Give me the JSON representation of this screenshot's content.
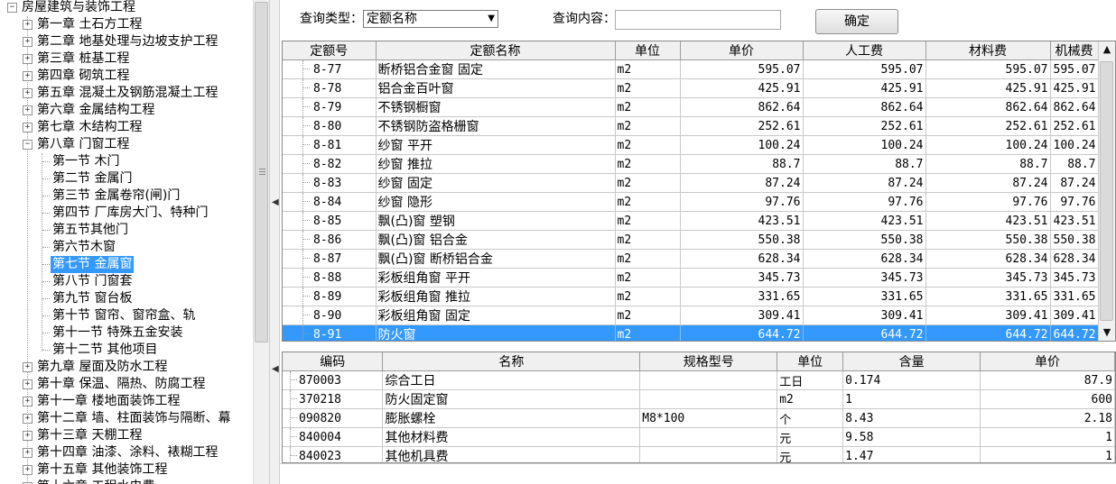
{
  "tree": {
    "root": "房屋建筑与装饰工程",
    "chapters": [
      "第一章 土石方工程",
      "第二章 地基处理与边坡支护工程",
      "第三章 桩基工程",
      "第四章 砌筑工程",
      "第五章 混凝土及钢筋混凝土工程",
      "第六章 金属结构工程",
      "第七章 木结构工程",
      "第八章 门窗工程",
      "第九章 屋面及防水工程",
      "第十章 保温、隔热、防腐工程",
      "第十一章 楼地面装饰工程",
      "第十二章 墙、柱面装饰与隔断、幕",
      "第十三章 天棚工程",
      "第十四章 油漆、涂料、裱糊工程",
      "第十五章 其他装饰工程",
      "第十六章 工程水电费"
    ],
    "chapter8_sections": [
      "第一节 木门",
      "第二节 金属门",
      "第三节 金属卷帘(闸)门",
      "第四节 厂库房大门、特种门",
      "第五节其他门",
      "第六节木窗",
      "第七节 金属窗",
      "第八节 门窗套",
      "第九节 窗台板",
      "第十节 窗帘、窗帘盒、轨",
      "第十一节 特殊五金安装",
      "第十二节 其他项目"
    ],
    "selected_section_index": 6
  },
  "toolbar": {
    "type_label": "查询类型：",
    "type_value": "定额名称",
    "content_label": "查询内容：",
    "content_value": "",
    "confirm_label": "确定"
  },
  "main_grid": {
    "headers": [
      "定额号",
      "定额名称",
      "单位",
      "单价",
      "人工费",
      "材料费",
      "机械费"
    ],
    "selected_row_index": 14,
    "rows": [
      [
        "8-77",
        "断桥铝合金窗 固定",
        "m2",
        "595.07",
        "595.07",
        "595.07",
        "595.07"
      ],
      [
        "8-78",
        "铝合金百叶窗",
        "m2",
        "425.91",
        "425.91",
        "425.91",
        "425.91"
      ],
      [
        "8-79",
        "不锈钢橱窗",
        "m2",
        "862.64",
        "862.64",
        "862.64",
        "862.64"
      ],
      [
        "8-80",
        "不锈钢防盗格栅窗",
        "m2",
        "252.61",
        "252.61",
        "252.61",
        "252.61"
      ],
      [
        "8-81",
        "纱窗 平开",
        "m2",
        "100.24",
        "100.24",
        "100.24",
        "100.24"
      ],
      [
        "8-82",
        "纱窗 推拉",
        "m2",
        "88.7",
        "88.7",
        "88.7",
        "88.7"
      ],
      [
        "8-83",
        "纱窗 固定",
        "m2",
        "87.24",
        "87.24",
        "87.24",
        "87.24"
      ],
      [
        "8-84",
        "纱窗 隐形",
        "m2",
        "97.76",
        "97.76",
        "97.76",
        "97.76"
      ],
      [
        "8-85",
        "飘(凸)窗 塑钢",
        "m2",
        "423.51",
        "423.51",
        "423.51",
        "423.51"
      ],
      [
        "8-86",
        "飘(凸)窗 铝合金",
        "m2",
        "550.38",
        "550.38",
        "550.38",
        "550.38"
      ],
      [
        "8-87",
        "飘(凸)窗 断桥铝合金",
        "m2",
        "628.34",
        "628.34",
        "628.34",
        "628.34"
      ],
      [
        "8-88",
        "彩板组角窗 平开",
        "m2",
        "345.73",
        "345.73",
        "345.73",
        "345.73"
      ],
      [
        "8-89",
        "彩板组角窗 推拉",
        "m2",
        "331.65",
        "331.65",
        "331.65",
        "331.65"
      ],
      [
        "8-90",
        "彩板组角窗 固定",
        "m2",
        "309.41",
        "309.41",
        "309.41",
        "309.41"
      ],
      [
        "8-91",
        "防火窗",
        "m2",
        "644.72",
        "644.72",
        "644.72",
        "644.72"
      ]
    ]
  },
  "detail_grid": {
    "headers": [
      "编码",
      "名称",
      "规格型号",
      "单位",
      "含量",
      "单价"
    ],
    "rows": [
      [
        "870003",
        "综合工日",
        "",
        "工日",
        "0.174",
        "87.9"
      ],
      [
        "370218",
        "防火固定窗",
        "",
        "m2",
        "1",
        "600"
      ],
      [
        "090820",
        "膨胀螺栓",
        "M8*100",
        "个",
        "8.43",
        "2.18"
      ],
      [
        "840004",
        "其他材料费",
        "",
        "元",
        "9.58",
        "1"
      ],
      [
        "840023",
        "其他机具费",
        "",
        "元",
        "1.47",
        "1"
      ]
    ]
  },
  "colors": {
    "selection": "#3399ff",
    "header_bg": "#f0f0f0"
  }
}
